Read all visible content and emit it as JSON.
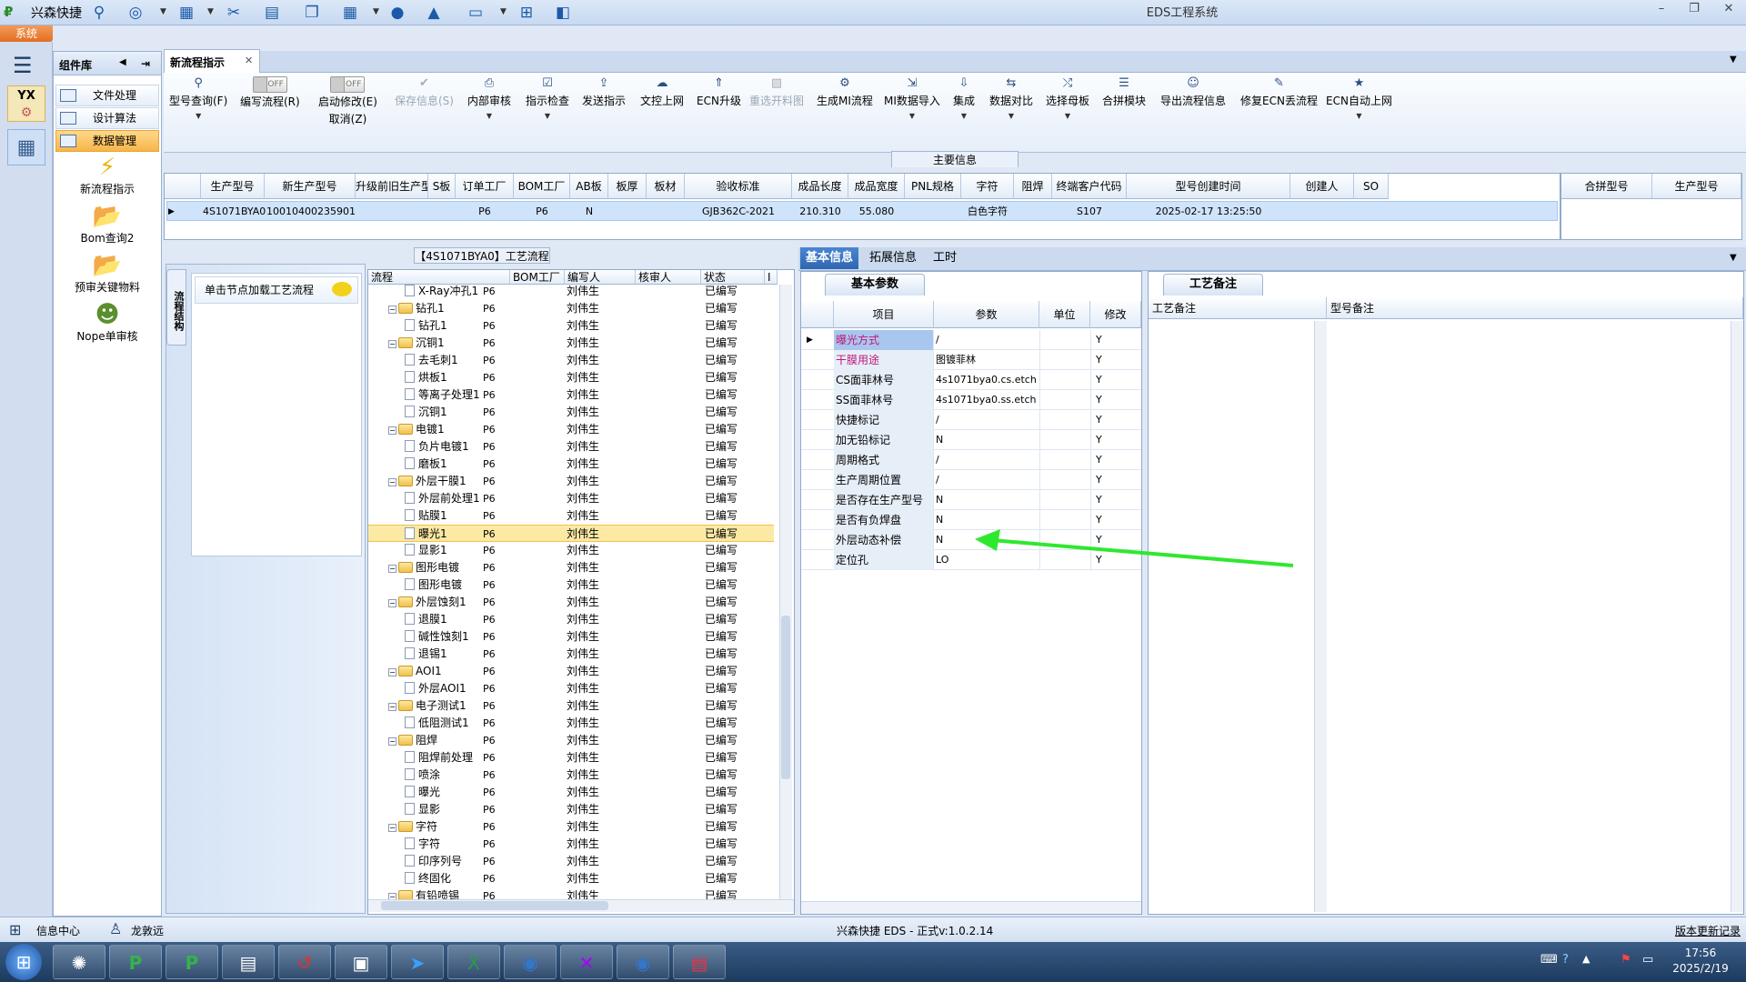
{
  "app": {
    "brand": "兴森快捷",
    "window_title": "EDS工程系统",
    "system_label": "系统"
  },
  "component_panel": {
    "title": "组件库",
    "items": [
      {
        "label": "文件处理"
      },
      {
        "label": "设计算法"
      },
      {
        "label": "数据管理",
        "active": true
      }
    ],
    "big_icons": [
      {
        "label": "新流程指示",
        "icon": "lightning-icon"
      },
      {
        "label": "Bom查询2",
        "icon": "folder-icon"
      },
      {
        "label": "预审关键物料",
        "icon": "folder-icon"
      },
      {
        "label": "Nope单审核",
        "icon": "user-icon"
      }
    ]
  },
  "tabs": [
    {
      "label": "新流程指示",
      "active": true
    }
  ],
  "toolbar": {
    "items": [
      {
        "label": "型号查询(F)",
        "icon": "search-icon"
      },
      {
        "label": "编写流程(R)",
        "toggle": "OFF"
      },
      {
        "label": "启动修改(E)",
        "label2": "取消(Z)",
        "toggle": "OFF"
      },
      {
        "label": "保存信息(S)",
        "icon": "check-icon",
        "disabled": true
      },
      {
        "label": "内部审核",
        "icon": "print-icon"
      },
      {
        "label": "指示检查",
        "icon": "checkbox-icon"
      },
      {
        "label": "发送指示",
        "icon": "upload-icon"
      },
      {
        "label": "文控上网",
        "icon": "cloud-upload-icon"
      },
      {
        "label": "ECN升级",
        "icon": "upgrade-icon"
      },
      {
        "label": "重选开料图",
        "icon": "image-icon",
        "disabled": true
      },
      {
        "label": "生成MI流程",
        "icon": "gears-icon"
      },
      {
        "label": "MI数据导入",
        "icon": "import-icon"
      },
      {
        "label": "集成",
        "icon": "download-icon"
      },
      {
        "label": "数据对比",
        "icon": "compare-icon"
      },
      {
        "label": "选择母板",
        "icon": "shuffle-icon"
      },
      {
        "label": "合拼模块",
        "icon": "list-icon"
      },
      {
        "label": "导出流程信息",
        "icon": "smile-icon"
      },
      {
        "label": "修复ECN丢流程",
        "icon": "wrench-icon"
      },
      {
        "label": "ECN自动上网",
        "icon": "star-icon"
      }
    ],
    "toggle_off": "OFF"
  },
  "main_info": {
    "section_title": "主要信息",
    "columns": [
      "生产型号",
      "新生产型号",
      "升级前旧生产型号",
      "S板",
      "订单工厂",
      "BOM工厂",
      "AB板",
      "板厚",
      "板材",
      "验收标准",
      "成品长度",
      "成品宽度",
      "PNL规格",
      "字符",
      "阻焊",
      "终端客户代码",
      "型号创建时间",
      "创建人",
      "SO"
    ],
    "row": [
      "4S1071BYA0",
      "10010400235901",
      "",
      "",
      "P6",
      "P6",
      "N",
      "",
      "",
      "GJB362C-2021",
      "210.310",
      "55.080",
      "",
      "白色字符",
      "",
      "S107",
      "2025-02-17 13:25:50",
      "",
      ""
    ],
    "right_columns": [
      "合拼型号",
      "生产型号"
    ]
  },
  "process": {
    "section_title": "【4S1071BYA0】工艺流程",
    "side_tab": "流程结构",
    "load_button": "单击节点加载工艺流程",
    "columns": [
      "流程",
      "BOM工厂",
      "编写人",
      "核审人",
      "状态",
      "I"
    ],
    "rows": [
      {
        "name": "X-Ray冲孔1",
        "level": 2,
        "type": "doc",
        "bom": "P6",
        "writer": "刘伟生",
        "status": "已编写",
        "partial": true
      },
      {
        "name": "钻孔1",
        "level": 1,
        "type": "folder",
        "bom": "P6",
        "writer": "刘伟生",
        "status": "已编写"
      },
      {
        "name": "钻孔1",
        "level": 2,
        "type": "doc",
        "bom": "P6",
        "writer": "刘伟生",
        "status": "已编写"
      },
      {
        "name": "沉铜1",
        "level": 1,
        "type": "folder",
        "bom": "P6",
        "writer": "刘伟生",
        "status": "已编写"
      },
      {
        "name": "去毛刺1",
        "level": 2,
        "type": "doc",
        "bom": "P6",
        "writer": "刘伟生",
        "status": "已编写"
      },
      {
        "name": "烘板1",
        "level": 2,
        "type": "doc",
        "bom": "P6",
        "writer": "刘伟生",
        "status": "已编写"
      },
      {
        "name": "等离子处理1",
        "level": 2,
        "type": "doc",
        "bom": "P6",
        "writer": "刘伟生",
        "status": "已编写"
      },
      {
        "name": "沉铜1",
        "level": 2,
        "type": "doc",
        "bom": "P6",
        "writer": "刘伟生",
        "status": "已编写"
      },
      {
        "name": "电镀1",
        "level": 1,
        "type": "folder",
        "bom": "P6",
        "writer": "刘伟生",
        "status": "已编写"
      },
      {
        "name": "负片电镀1",
        "level": 2,
        "type": "doc",
        "bom": "P6",
        "writer": "刘伟生",
        "status": "已编写"
      },
      {
        "name": "磨板1",
        "level": 2,
        "type": "doc",
        "bom": "P6",
        "writer": "刘伟生",
        "status": "已编写"
      },
      {
        "name": "外层干膜1",
        "level": 1,
        "type": "folder",
        "bom": "P6",
        "writer": "刘伟生",
        "status": "已编写"
      },
      {
        "name": "外层前处理1",
        "level": 2,
        "type": "doc",
        "bom": "P6",
        "writer": "刘伟生",
        "status": "已编写"
      },
      {
        "name": "贴膜1",
        "level": 2,
        "type": "doc",
        "bom": "P6",
        "writer": "刘伟生",
        "status": "已编写"
      },
      {
        "name": "曝光1",
        "level": 2,
        "type": "doc",
        "bom": "P6",
        "writer": "刘伟生",
        "status": "已编写",
        "selected": true
      },
      {
        "name": "显影1",
        "level": 2,
        "type": "doc",
        "bom": "P6",
        "writer": "刘伟生",
        "status": "已编写"
      },
      {
        "name": "图形电镀",
        "level": 1,
        "type": "folder",
        "bom": "P6",
        "writer": "刘伟生",
        "status": "已编写"
      },
      {
        "name": "图形电镀",
        "level": 2,
        "type": "doc",
        "bom": "P6",
        "writer": "刘伟生",
        "status": "已编写"
      },
      {
        "name": "外层蚀刻1",
        "level": 1,
        "type": "folder",
        "bom": "P6",
        "writer": "刘伟生",
        "status": "已编写"
      },
      {
        "name": "退膜1",
        "level": 2,
        "type": "doc",
        "bom": "P6",
        "writer": "刘伟生",
        "status": "已编写"
      },
      {
        "name": "碱性蚀刻1",
        "level": 2,
        "type": "doc",
        "bom": "P6",
        "writer": "刘伟生",
        "status": "已编写"
      },
      {
        "name": "退锡1",
        "level": 2,
        "type": "doc",
        "bom": "P6",
        "writer": "刘伟生",
        "status": "已编写"
      },
      {
        "name": "AOI1",
        "level": 1,
        "type": "folder",
        "bom": "P6",
        "writer": "刘伟生",
        "status": "已编写"
      },
      {
        "name": "外层AOI1",
        "level": 2,
        "type": "doc",
        "bom": "P6",
        "writer": "刘伟生",
        "status": "已编写"
      },
      {
        "name": "电子测试1",
        "level": 1,
        "type": "folder",
        "bom": "P6",
        "writer": "刘伟生",
        "status": "已编写"
      },
      {
        "name": "低阻测试1",
        "level": 2,
        "type": "doc",
        "bom": "P6",
        "writer": "刘伟生",
        "status": "已编写"
      },
      {
        "name": "阻焊",
        "level": 1,
        "type": "folder",
        "bom": "P6",
        "writer": "刘伟生",
        "status": "已编写"
      },
      {
        "name": "阻焊前处理",
        "level": 2,
        "type": "doc",
        "bom": "P6",
        "writer": "刘伟生",
        "status": "已编写"
      },
      {
        "name": "喷涂",
        "level": 2,
        "type": "doc",
        "bom": "P6",
        "writer": "刘伟生",
        "status": "已编写"
      },
      {
        "name": "曝光",
        "level": 2,
        "type": "doc",
        "bom": "P6",
        "writer": "刘伟生",
        "status": "已编写"
      },
      {
        "name": "显影",
        "level": 2,
        "type": "doc",
        "bom": "P6",
        "writer": "刘伟生",
        "status": "已编写"
      },
      {
        "name": "字符",
        "level": 1,
        "type": "folder",
        "bom": "P6",
        "writer": "刘伟生",
        "status": "已编写"
      },
      {
        "name": "字符",
        "level": 2,
        "type": "doc",
        "bom": "P6",
        "writer": "刘伟生",
        "status": "已编写"
      },
      {
        "name": "印序列号",
        "level": 2,
        "type": "doc",
        "bom": "P6",
        "writer": "刘伟生",
        "status": "已编写"
      },
      {
        "name": "终固化",
        "level": 2,
        "type": "doc",
        "bom": "P6",
        "writer": "刘伟生",
        "status": "已编写"
      },
      {
        "name": "有铅喷锡",
        "level": 1,
        "type": "folder",
        "bom": "P6",
        "writer": "刘伟生",
        "status": "已编写",
        "partial": true
      }
    ]
  },
  "info_tabs": [
    {
      "label": "基本信息",
      "active": true
    },
    {
      "label": "拓展信息"
    },
    {
      "label": "工时"
    }
  ],
  "basic_params": {
    "title": "基本参数",
    "columns": [
      "项目",
      "参数",
      "单位",
      "修改"
    ],
    "rows": [
      {
        "key": "曝光方式",
        "value": "/",
        "unit": "",
        "mod": "Y",
        "highlight": true
      },
      {
        "key": "干膜用途",
        "value": "图镀菲林",
        "unit": "",
        "mod": "Y",
        "highlight": true
      },
      {
        "key": "CS面菲林号",
        "value": "4s1071bya0.cs.etch",
        "unit": "",
        "mod": "Y"
      },
      {
        "key": "SS面菲林号",
        "value": "4s1071bya0.ss.etch",
        "unit": "",
        "mod": "Y"
      },
      {
        "key": "快捷标记",
        "value": "/",
        "unit": "",
        "mod": "Y"
      },
      {
        "key": "加无铅标记",
        "value": "N",
        "unit": "",
        "mod": "Y"
      },
      {
        "key": "周期格式",
        "value": "/",
        "unit": "",
        "mod": "Y"
      },
      {
        "key": "生产周期位置",
        "value": "/",
        "unit": "",
        "mod": "Y"
      },
      {
        "key": "是否存在生产型号",
        "value": "N",
        "unit": "",
        "mod": "Y"
      },
      {
        "key": "是否有负焊盘",
        "value": "N",
        "unit": "",
        "mod": "Y"
      },
      {
        "key": "外层动态补偿",
        "value": "N",
        "unit": "",
        "mod": "Y"
      },
      {
        "key": "定位孔",
        "value": "LO",
        "unit": "",
        "mod": "Y"
      }
    ]
  },
  "notes": {
    "title": "工艺备注",
    "columns": [
      "工艺备注",
      "型号备注"
    ]
  },
  "status_bar": {
    "info_center": "信息中心",
    "user": "龙敦远",
    "version": "兴森快捷 EDS - 正式v:1.0.2.14",
    "changelog": "版本更新记录"
  },
  "taskbar": {
    "time": "17:56",
    "date": "2025/2/19"
  },
  "colors": {
    "accent": "#2f66b0",
    "highlight_row": "#fce9a4",
    "arrow": "#2ee82e",
    "orange": "#e36e22",
    "param_highlight": "#c2187a"
  }
}
